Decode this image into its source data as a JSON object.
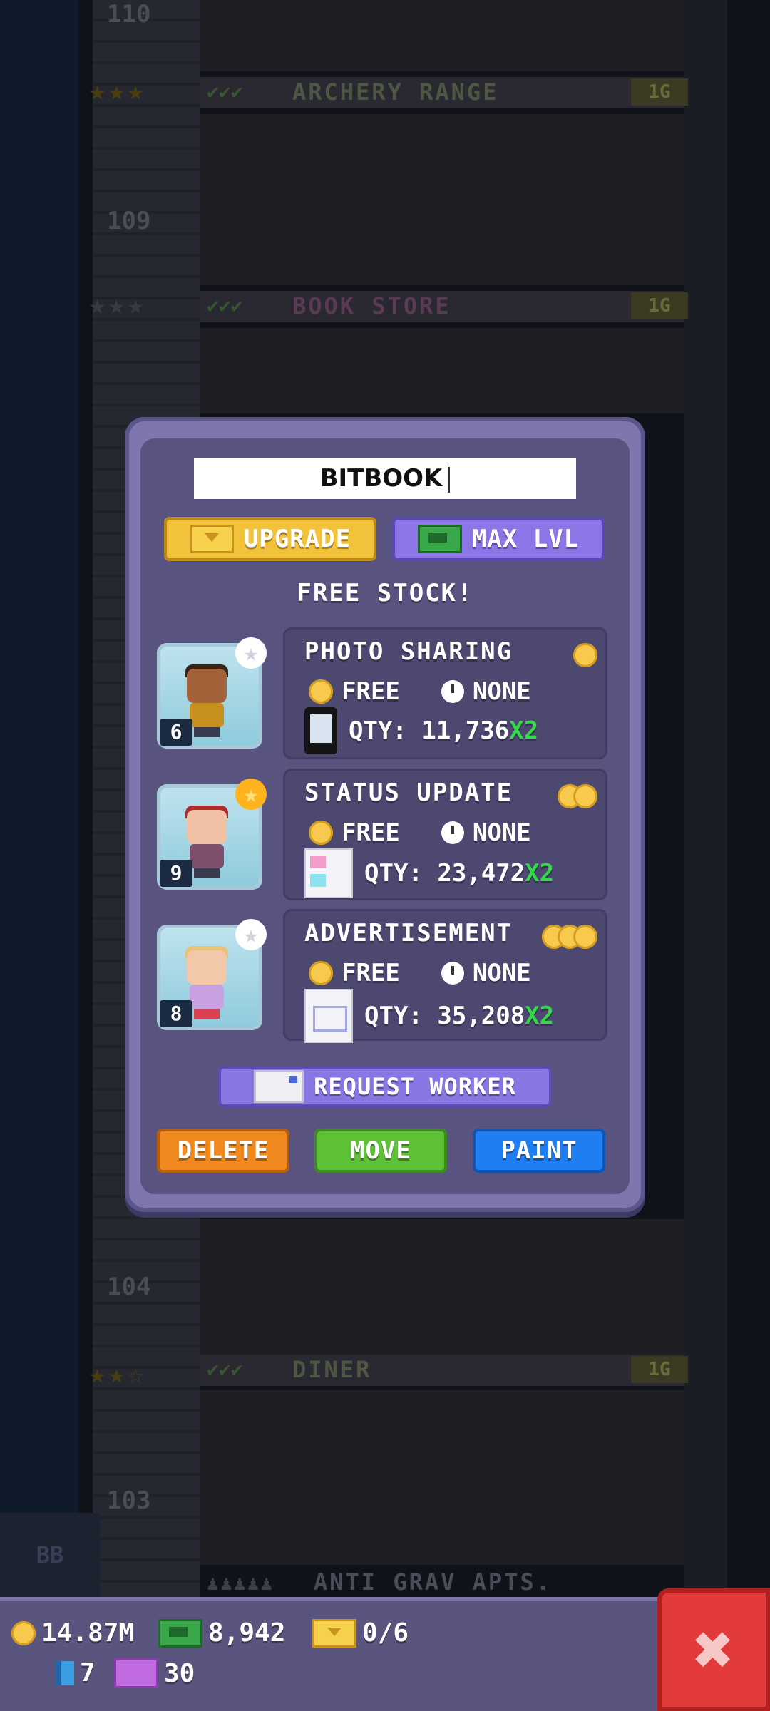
{
  "background": {
    "floor_numbers": [
      "110",
      "109",
      "104",
      "103"
    ],
    "floors": [
      {
        "checks": "✔✔✔",
        "name": "ARCHERY RANGE",
        "tag": "1G"
      },
      {
        "checks": "✔✔✔",
        "name": "BOOK STORE",
        "tag": "1G"
      },
      {
        "checks": "✔✔✔",
        "name": "DINER",
        "tag": "1G"
      }
    ],
    "bb_label": "BB",
    "bottom_floor": "ANTI GRAV APTS."
  },
  "dialog": {
    "name_value": "BITBOOK",
    "upgrade_label": "UPGRADE",
    "max_label": "MAX LVL",
    "free_stock": "FREE STOCK!",
    "products": [
      {
        "title": "PHOTO SHARING",
        "coins": 1,
        "cost": "FREE",
        "time": "NONE",
        "qty": "QTY: 11,736",
        "mult": "X2",
        "worker_level": "6",
        "star": "silver"
      },
      {
        "title": "STATUS UPDATE",
        "coins": 2,
        "cost": "FREE",
        "time": "NONE",
        "qty": "QTY: 23,472",
        "mult": "X2",
        "worker_level": "9",
        "star": "gold"
      },
      {
        "title": "ADVERTISEMENT",
        "coins": 3,
        "cost": "FREE",
        "time": "NONE",
        "qty": "QTY: 35,208",
        "mult": "X2",
        "worker_level": "8",
        "star": "silver"
      }
    ],
    "request_worker": "REQUEST WORKER",
    "delete_label": "DELETE",
    "move_label": "MOVE",
    "paint_label": "PAINT"
  },
  "hud": {
    "coins": "14.87M",
    "cash": "8,942",
    "tickets": "0/6",
    "bux": "7",
    "vip": "30"
  },
  "colors": {
    "accent_gold": "#f2c23a",
    "accent_purple": "#8c75e6",
    "delete": "#f08a1e",
    "move": "#5fc236",
    "paint": "#1f7ef2",
    "close": "#e23a3a",
    "multiplier": "#35d84a"
  }
}
